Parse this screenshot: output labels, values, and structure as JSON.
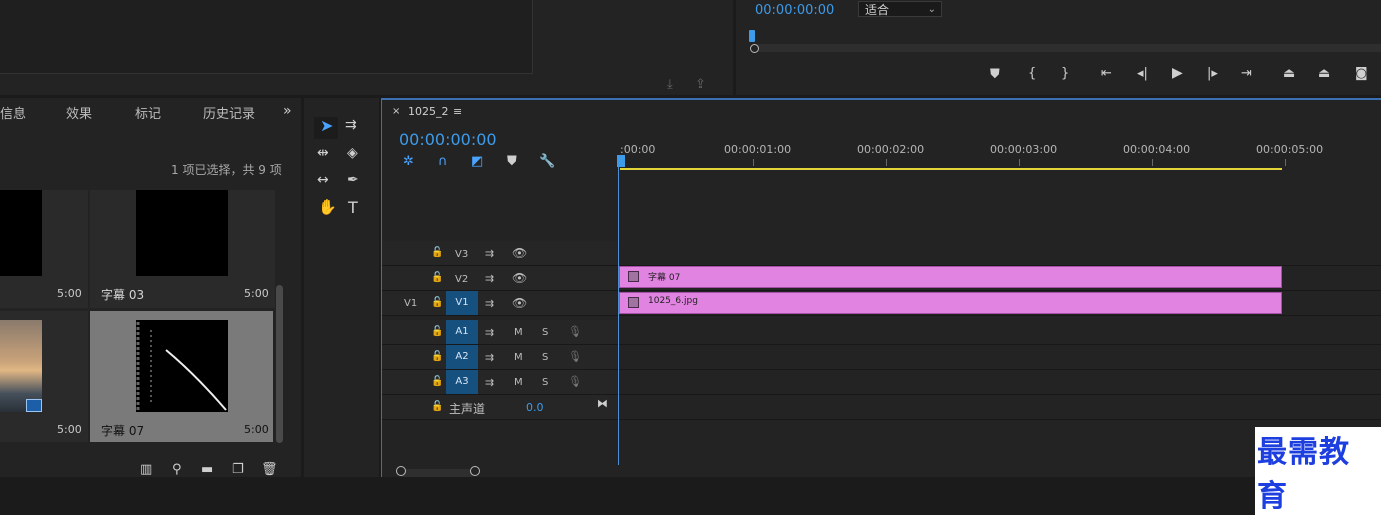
{
  "program_monitor": {
    "timecode": "00:00:00:00",
    "fit_value": "适合"
  },
  "project_panel": {
    "tabs": [
      "信息",
      "效果",
      "标记",
      "历史记录"
    ],
    "selection_status": "1 项已选择，共 9 项",
    "items": [
      {
        "name": "",
        "duration": "5:00"
      },
      {
        "name": "字幕 03",
        "duration": "5:00"
      },
      {
        "name": "",
        "duration": "5:00"
      },
      {
        "name": "字幕 07",
        "duration": "5:00"
      }
    ]
  },
  "timeline": {
    "sequence_tab": "1025_2",
    "timecode": "00:00:00:00",
    "ruler_labels": [
      ":00:00",
      "00:00:01:00",
      "00:00:02:00",
      "00:00:03:00",
      "00:00:04:00",
      "00:00:05:00"
    ],
    "video_tracks": [
      {
        "name": "V3",
        "source": ""
      },
      {
        "name": "V2",
        "source": ""
      },
      {
        "name": "V1",
        "source": "V1"
      }
    ],
    "audio_tracks": [
      {
        "name": "A1",
        "m": "M",
        "s": "S"
      },
      {
        "name": "A2",
        "m": "M",
        "s": "S"
      },
      {
        "name": "A3",
        "m": "M",
        "s": "S"
      }
    ],
    "master": {
      "label": "主声道",
      "value": "0.0"
    },
    "clips": [
      {
        "track": "V2",
        "label": "字幕 07"
      },
      {
        "track": "V1",
        "label": "1025_6.jpg"
      }
    ]
  },
  "watermark": "最需教育",
  "colors": {
    "accent": "#3d9be9",
    "clip": "#e183e1",
    "work_area": "#e3d539",
    "track_target": "#15507e"
  }
}
